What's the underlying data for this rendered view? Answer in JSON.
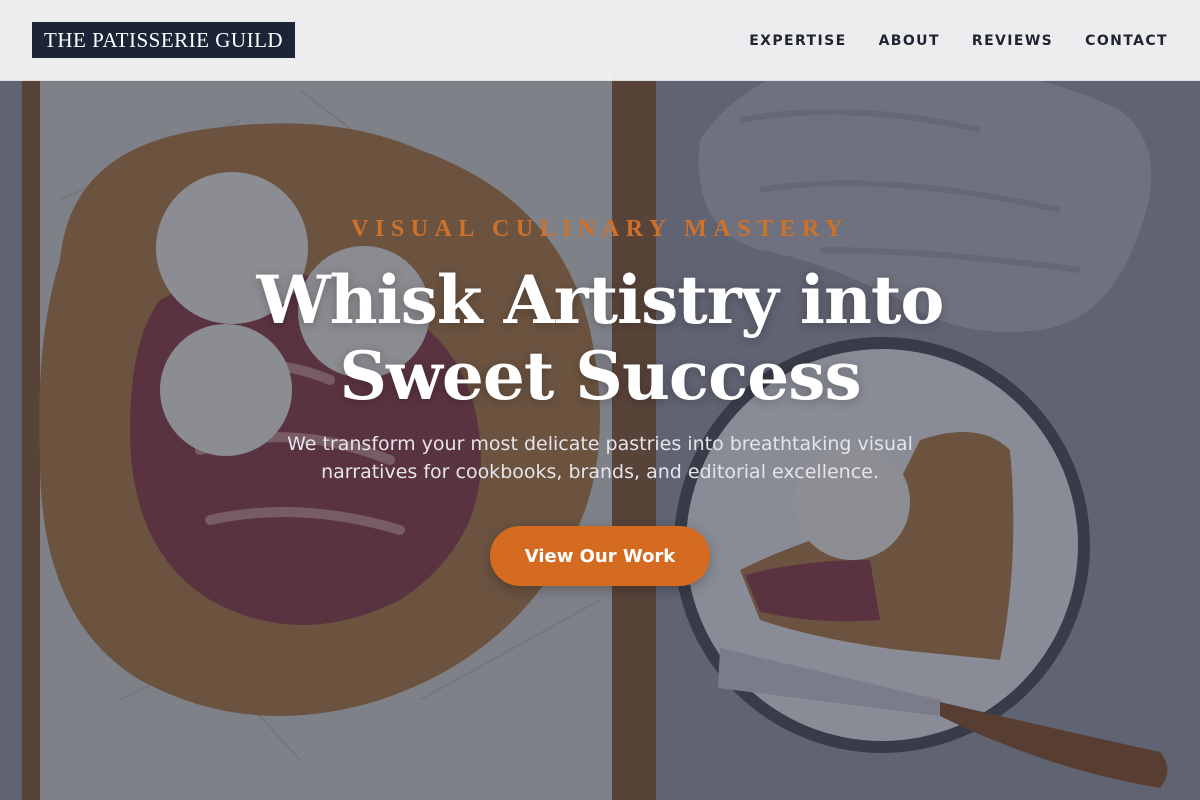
{
  "header": {
    "logo_text": "THE PATISSERIE GUILD",
    "nav": [
      {
        "label": "EXPERTISE"
      },
      {
        "label": "ABOUT"
      },
      {
        "label": "REVIEWS"
      },
      {
        "label": "CONTACT"
      }
    ]
  },
  "hero": {
    "eyebrow": "VISUAL CULINARY MASTERY",
    "headline": "Whisk Artistry into Sweet Success",
    "subtitle": "We transform your most delicate pastries into breathtaking visual narratives for cookbooks, brands, and editorial excellence.",
    "cta_label": "View Our Work"
  },
  "colors": {
    "accent": "#d46b21",
    "eyebrow": "#d0712a",
    "logo_bg": "#1c2537",
    "header_bg": "#f2f2f4",
    "nav_text": "#1f2433"
  }
}
